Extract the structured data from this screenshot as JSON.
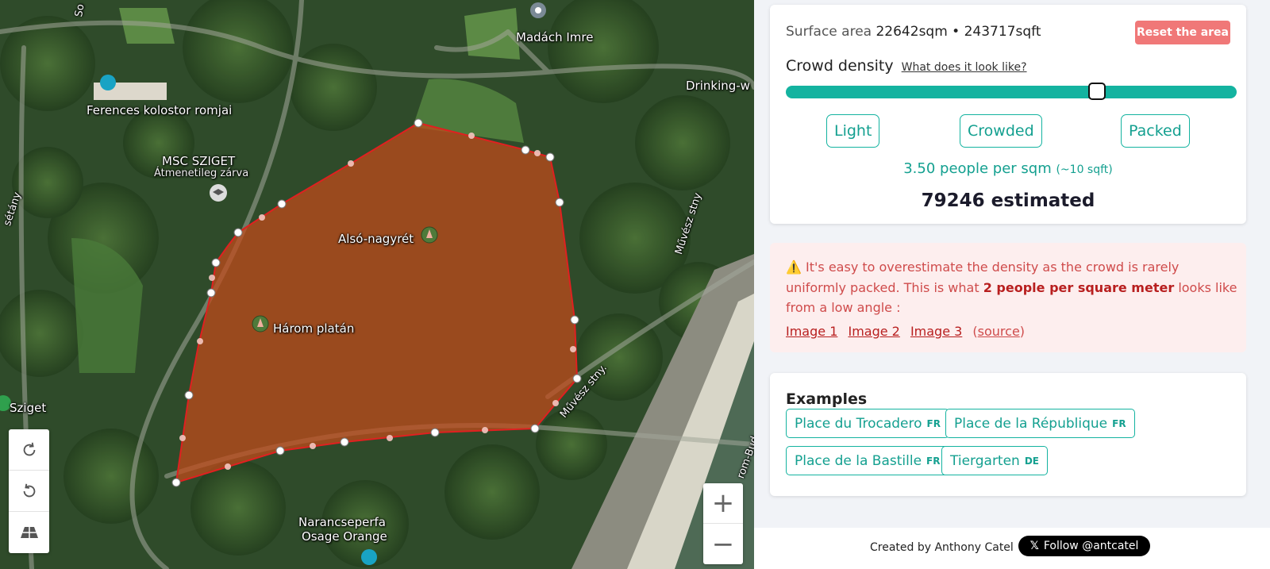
{
  "map": {
    "labels": {
      "madach": "Madách Imre",
      "drinking": "Drinking-w",
      "ferences": "Ferences kolostor romjai",
      "msc": "MSC SZIGET",
      "msc_sub": "Átmenetileg zárva",
      "also": "Alsó-nagyrét",
      "harom": "Három platán",
      "sziget": "Sziget",
      "muvesz1": "Művész stny",
      "muvesz2": "Művész stny.",
      "narancs1": "Narancseperfa",
      "narancs2": "Osage Orange",
      "setany": "sétány",
      "so": "So",
      "rom": "rom-Bud"
    },
    "controls": {
      "rotate_cw": "rotate-clockwise-icon",
      "rotate_ccw": "rotate-counterclockwise-icon",
      "tilt": "tilt-3d-icon",
      "zoom_in": "+",
      "zoom_out": "−"
    },
    "polygon_color": "#c44a1a"
  },
  "panel": {
    "surface_label": "Surface area",
    "surface_value": "22642sqm • 243717sqft",
    "reset_label": "Reset the area",
    "density_label": "Crowd density",
    "density_link": "What does it look like?",
    "slider_fraction": 0.69,
    "presets": [
      "Light",
      "Crowded",
      "Packed"
    ],
    "people_per_sqm": "3.50 people per sqm",
    "sqft_hint": "(~10 sqft)",
    "estimate": "79246 estimated",
    "accent_color": "#14b3a0"
  },
  "warning": {
    "icon": "⚠️",
    "text_before": "It's easy to overestimate the density as the crowd is rarely uniformly packed. This is what",
    "text_bold": "2 people per square meter",
    "text_after": "looks like from a low angle :",
    "images": [
      "Image 1",
      "Image 2",
      "Image 3"
    ],
    "source": "source"
  },
  "examples": {
    "title": "Examples",
    "items": [
      {
        "name": "Place du Trocadero",
        "cc": "FR"
      },
      {
        "name": "Place de la République",
        "cc": "FR"
      },
      {
        "name": "Place de la Bastille",
        "cc": "FR"
      },
      {
        "name": "Tiergarten",
        "cc": "DE"
      }
    ]
  },
  "footer": {
    "credit": "Created by Anthony Catel",
    "follow": "Follow @antcatel",
    "x": "𝕏"
  }
}
